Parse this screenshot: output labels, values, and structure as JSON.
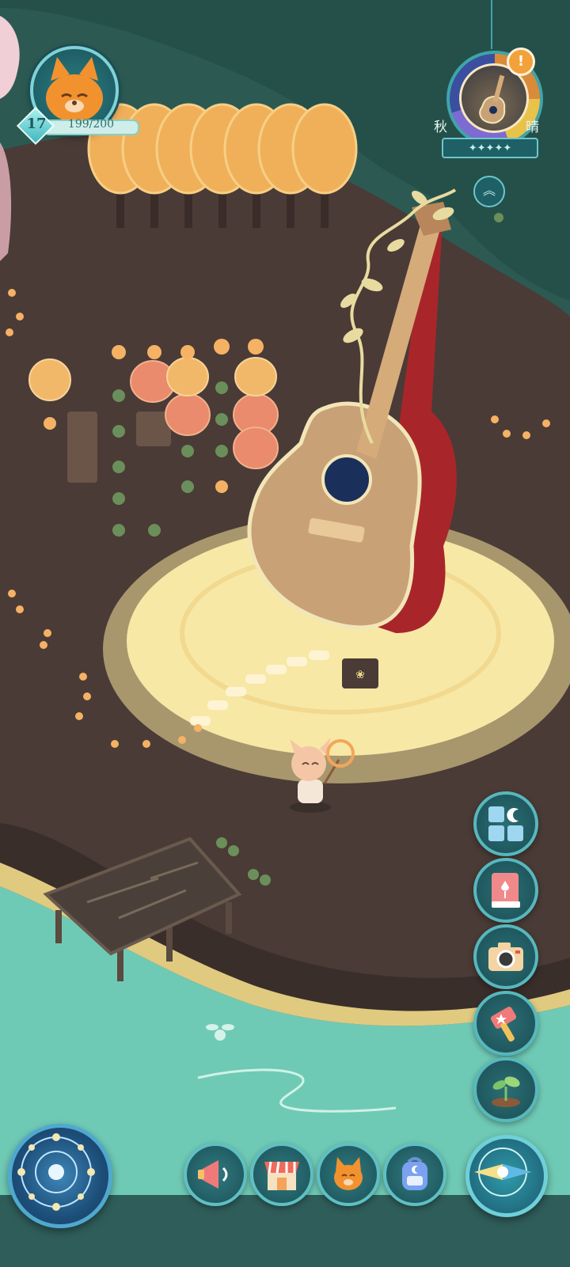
{
  "player": {
    "level": "17",
    "exp_text": "199/200",
    "avatar_icon": "fox-cat-face-icon"
  },
  "season": {
    "season_label": "秋",
    "weather_label": "晴",
    "alert_mark": "!",
    "stars": "✦✦✦✦✦",
    "placed_item_icon": "guitar-icon",
    "expand_icon": "double-chevron-up-icon"
  },
  "side_buttons": [
    {
      "name": "build-menu-button",
      "icon": "grid-moon-icon"
    },
    {
      "name": "handbook-button",
      "icon": "tulip-book-icon"
    },
    {
      "name": "camera-button",
      "icon": "camera-icon"
    },
    {
      "name": "event-button",
      "icon": "hammer-star-icon"
    },
    {
      "name": "garden-button",
      "icon": "sprout-icon"
    }
  ],
  "bottom_buttons": [
    {
      "name": "announcement-button",
      "icon": "megaphone-icon"
    },
    {
      "name": "shop-button",
      "icon": "shop-icon"
    },
    {
      "name": "friends-button",
      "icon": "fox-face-icon"
    },
    {
      "name": "backpack-button",
      "icon": "backpack-icon"
    }
  ],
  "colors": {
    "sea": "#6fcab5",
    "forest": "#2c5a52",
    "dirt": "#4a3b36",
    "sand": "#f2dc8a",
    "accent_teal": "#57b8bd"
  }
}
